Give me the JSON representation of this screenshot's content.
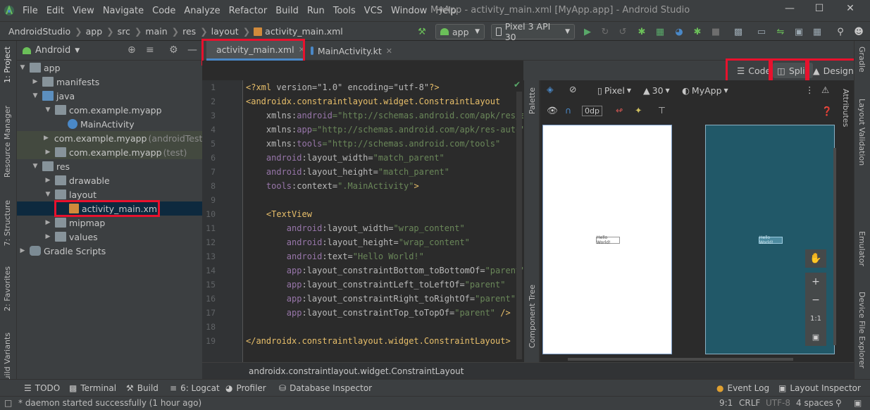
{
  "menu": [
    "File",
    "Edit",
    "View",
    "Navigate",
    "Code",
    "Analyze",
    "Refactor",
    "Build",
    "Run",
    "Tools",
    "VCS",
    "Window",
    "Help"
  ],
  "window_title": "MyApp - activity_main.xml [MyApp.app] - Android Studio",
  "breadcrumbs": [
    "AndroidStudio",
    "app",
    "src",
    "main",
    "res",
    "layout",
    "activity_main.xml"
  ],
  "run_config": "app",
  "device": "Pixel 3 API 30",
  "project_panel": {
    "view_mode": "Android",
    "tree": [
      {
        "label": "app",
        "muted": ""
      },
      {
        "label": "manifests",
        "muted": ""
      },
      {
        "label": "java",
        "muted": ""
      },
      {
        "label": "com.example.myapp",
        "muted": ""
      },
      {
        "label": "MainActivity",
        "muted": ""
      },
      {
        "label": "com.example.myapp",
        "muted": "(androidTest)"
      },
      {
        "label": "com.example.myapp",
        "muted": "(test)"
      },
      {
        "label": "res",
        "muted": ""
      },
      {
        "label": "drawable",
        "muted": ""
      },
      {
        "label": "layout",
        "muted": ""
      },
      {
        "label": "activity_main.xml",
        "muted": ""
      },
      {
        "label": "mipmap",
        "muted": ""
      },
      {
        "label": "values",
        "muted": ""
      },
      {
        "label": "Gradle Scripts",
        "muted": ""
      }
    ]
  },
  "left_tool_tabs": [
    "1: Project",
    "Resource Manager",
    "7: Structure",
    "2: Favorites",
    "Build Variants"
  ],
  "right_tool_tabs": [
    "Gradle",
    "Layout Validation",
    "Emulator",
    "Device File Explorer"
  ],
  "editor_tabs": [
    "activity_main.xml",
    "MainActivity.kt"
  ],
  "view_modes": {
    "code": "Code",
    "split": "Split",
    "design": "Design"
  },
  "code": {
    "line_numbers": [
      "1",
      "2",
      "3",
      "4",
      "5",
      "6",
      "7",
      "8",
      "9",
      "10",
      "11",
      "12",
      "13",
      "14",
      "15",
      "16",
      "17",
      "18",
      "19"
    ],
    "line1_decl": "<?xml ",
    "line1_attrs": "version=\"1.0\" encoding=\"utf-8\"",
    "line1_end": "?>",
    "root_tag": "<androidx.constraintlayout.widget.ConstraintLayout",
    "root_close": "</androidx.constraintlayout.widget.ConstraintLayout>",
    "ns_android_key": "xmlns:",
    "ns_android_name": "android",
    "ns_android_val": "=\"http://schemas.android.com/apk/res/an",
    "ns_app_name": "app",
    "ns_app_val": "=\"http://schemas.android.com/apk/res-auto\"",
    "ns_tools_name": "tools",
    "ns_tools_val": "=\"http://schemas.android.com/tools\"",
    "root_width_ns": "android",
    "root_width_attr": ":layout_width=",
    "root_width_val": "\"match_parent\"",
    "root_height_attr": ":layout_height=",
    "root_height_val": "\"match_parent\"",
    "tools_ns": "tools",
    "tools_context_attr": ":context=",
    "tools_context_val": "\".MainActivity\"",
    "tools_context_end": ">",
    "tv_tag": "<TextView",
    "tv_width_val": "\"wrap_content\"",
    "tv_height_val": "\"wrap_content\"",
    "tv_text_attr": ":text=",
    "tv_text_val": "\"Hello World!\"",
    "app_ns": "app",
    "c_bottom": ":layout_constraintBottom_toBottomOf=",
    "c_left": ":layout_constraintLeft_toLeftOf=",
    "c_right": ":layout_constraintRight_toRightOf=",
    "c_top": ":layout_constraintTop_toTopOf=",
    "parent_val": "\"parent\"",
    "self_close": " />"
  },
  "design_toolbar": {
    "device": "Pixel",
    "api": "30",
    "theme": "MyApp",
    "margin": "0dp"
  },
  "palette_tabs": [
    "Palette",
    "Component Tree"
  ],
  "attributes_tab": "Attributes",
  "preview_text": "Hello World!",
  "zoom": {
    "fit": "1:1"
  },
  "status_line": "androidx.constraintlayout.widget.ConstraintLayout",
  "bottom_tools": [
    "TODO",
    "Terminal",
    "Build",
    "6: Logcat",
    "Profiler",
    "Database Inspector",
    "Event Log",
    "Layout Inspector"
  ],
  "status_bar": {
    "message": "* daemon started successfully (1 hour ago)",
    "position": "9:1",
    "line_sep": "CRLF",
    "encoding": "UTF-8",
    "indent": "4 spaces"
  },
  "colors": {
    "highlight": "#e8112d",
    "accent": "#4a88c7",
    "device_blueprint": "#215868"
  }
}
